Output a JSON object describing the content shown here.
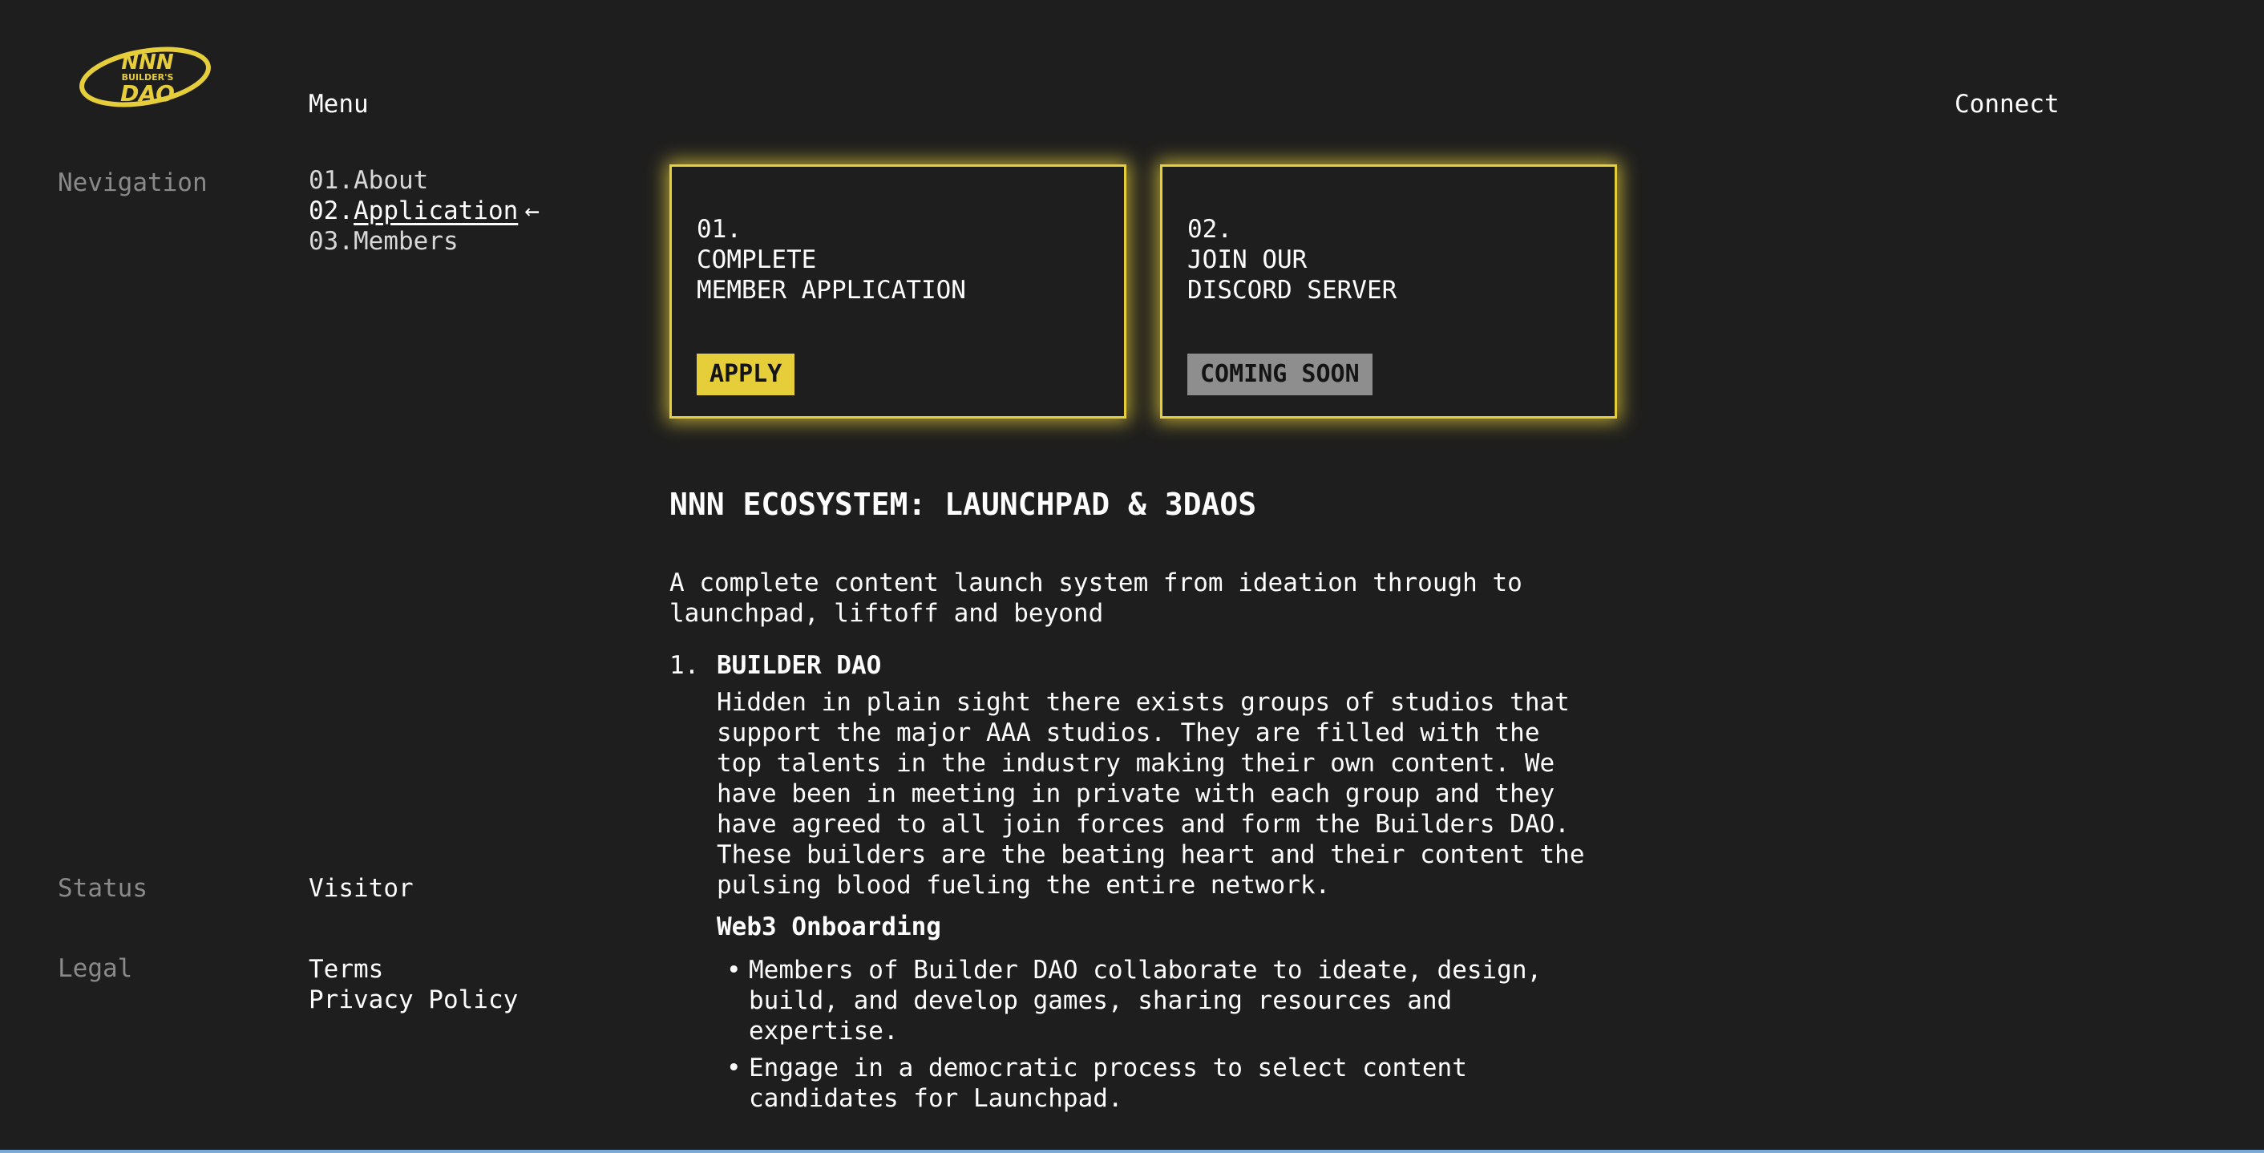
{
  "logo": {
    "line1": "NNN",
    "line2": "BUILDER'S",
    "line3": "DAO",
    "color": "#e6ce3a"
  },
  "header": {
    "menu_label": "Menu",
    "connect_label": "Connect"
  },
  "sidebar": {
    "navigation_label": "Nevigation",
    "nav_items": [
      {
        "num": "01.",
        "label": "About"
      },
      {
        "num": "02.",
        "label": "Application",
        "active": true,
        "arrow": "←"
      },
      {
        "num": "03.",
        "label": "Members"
      }
    ],
    "status_label": "Status",
    "status_value": "Visitor",
    "legal_label": "Legal",
    "legal_links": [
      "Terms",
      "Privacy Policy"
    ]
  },
  "cards": [
    {
      "num": "01.",
      "line1": "COMPLETE",
      "line2": "MEMBER APPLICATION",
      "button": "APPLY",
      "button_color": "#e6ce3a"
    },
    {
      "num": "02.",
      "line1": "JOIN OUR",
      "line2": "DISCORD SERVER",
      "button": "COMING SOON",
      "button_color": "#8e8e8e"
    }
  ],
  "main": {
    "title": "NNN ECOSYSTEM: LAUNCHPAD & 3DAOS",
    "intro_line1": "A complete content launch system from ideation through to",
    "intro_line2": "launchpad, liftoff and beyond",
    "sections": [
      {
        "num": "1.",
        "title": "BUILDER DAO",
        "body_lines": [
          "Hidden in plain sight there exists groups of studios that",
          "support the major AAA studios. They are filled with the",
          "top talents in the industry making their own content. We",
          "have been in meeting in private with each group and they",
          "have agreed to all join forces and form the Builders DAO.",
          "These builders are the beating heart and their content the",
          "pulsing blood fueling the entire network."
        ],
        "subtitle": "Web3 Onboarding",
        "bullets": [
          [
            "Members of Builder DAO collaborate to ideate, design,",
            "build, and develop games, sharing resources and",
            "expertise."
          ],
          [
            "Engage in a democratic process to select content",
            "candidates for Launchpad."
          ]
        ]
      }
    ]
  },
  "colors": {
    "background": "#1e1e1e",
    "accent": "#e6ce3a",
    "muted_text": "#8a8a8a",
    "disabled_button": "#8e8e8e"
  }
}
